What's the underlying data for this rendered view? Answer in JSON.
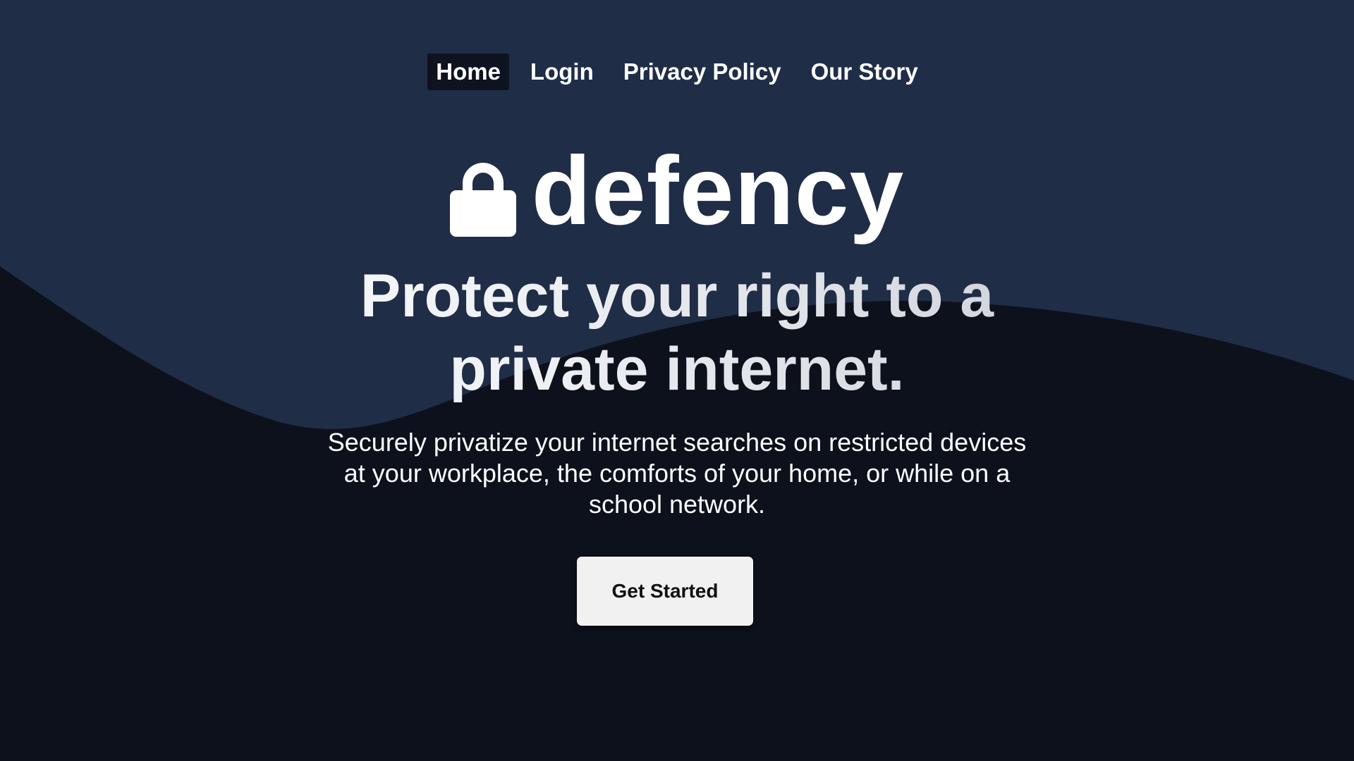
{
  "nav": {
    "items": [
      {
        "label": "Home",
        "active": true
      },
      {
        "label": "Login",
        "active": false
      },
      {
        "label": "Privacy Policy",
        "active": false
      },
      {
        "label": "Our Story",
        "active": false
      }
    ]
  },
  "logo": {
    "icon": "lock-icon",
    "brand": "defency"
  },
  "hero": {
    "headline": "Protect your right to a private internet.",
    "subtitle": "Securely privatize your internet searches on restricted devices at your workplace, the comforts of your home, or while on a school network.",
    "cta_label": "Get Started"
  },
  "colors": {
    "upper_background": "#1f2d47",
    "lower_background": "#0d111c",
    "active_nav_background": "#0e1320",
    "button_background": "#f1f1f2",
    "text": "#ffffff"
  }
}
